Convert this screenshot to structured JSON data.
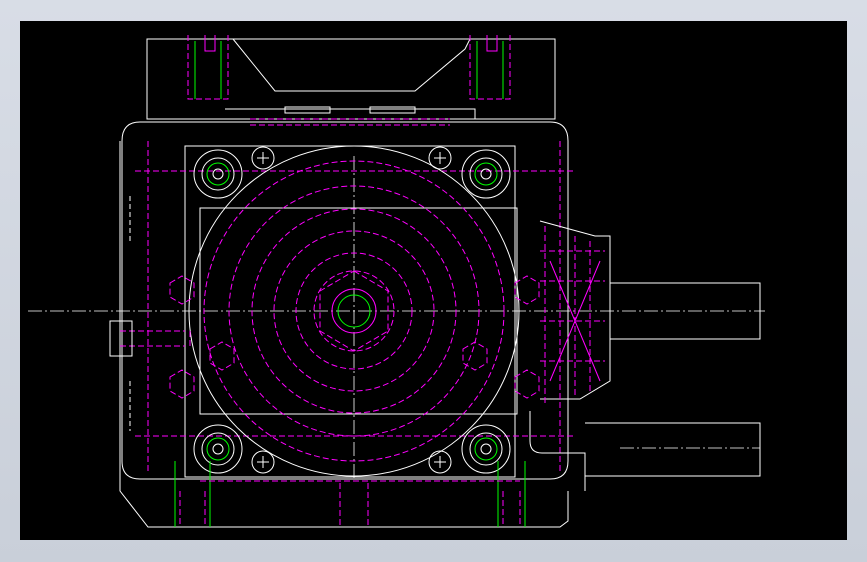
{
  "drawing": {
    "background": "#000000",
    "colors": {
      "outline": "#ffffff",
      "hidden_lines": "#ff00ff",
      "thread_marks": "#00ff00",
      "frame": "#c9cfd9"
    }
  }
}
